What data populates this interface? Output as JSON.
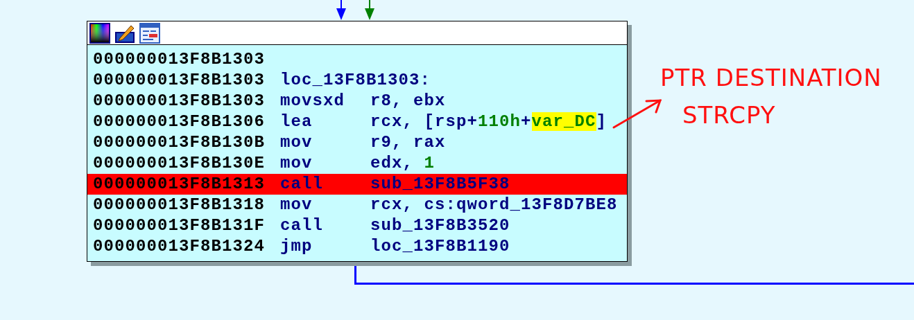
{
  "node": {
    "lines": [
      {
        "address": "000000013F8B1303",
        "selected": false
      },
      {
        "address": "000000013F8B1303",
        "label": "loc_13F8B1303:",
        "selected": false
      },
      {
        "address": "000000013F8B1303",
        "mnemonic": "movsxd",
        "operands": [
          {
            "kind": "plain",
            "text": "r8, ebx"
          }
        ],
        "selected": false
      },
      {
        "address": "000000013F8B1306",
        "mnemonic": "lea",
        "operands": [
          {
            "kind": "plain",
            "text": "rcx, [rsp+"
          },
          {
            "kind": "number",
            "text": "110h"
          },
          {
            "kind": "plain",
            "text": "+"
          },
          {
            "kind": "highlight",
            "text": "var_DC"
          },
          {
            "kind": "plain",
            "text": "]"
          }
        ],
        "selected": false
      },
      {
        "address": "000000013F8B130B",
        "mnemonic": "mov",
        "operands": [
          {
            "kind": "plain",
            "text": "r9, rax"
          }
        ],
        "selected": false
      },
      {
        "address": "000000013F8B130E",
        "mnemonic": "mov",
        "operands": [
          {
            "kind": "plain",
            "text": "edx, "
          },
          {
            "kind": "number",
            "text": "1"
          }
        ],
        "selected": false
      },
      {
        "address": "000000013F8B1313",
        "mnemonic": "call",
        "operands": [
          {
            "kind": "plain",
            "text": "sub_13F8B5F38"
          }
        ],
        "selected": true
      },
      {
        "address": "000000013F8B1318",
        "mnemonic": "mov",
        "operands": [
          {
            "kind": "plain",
            "text": "rcx, cs:qword_13F8D7BE8"
          }
        ],
        "selected": false
      },
      {
        "address": "000000013F8B131F",
        "mnemonic": "call",
        "operands": [
          {
            "kind": "plain",
            "text": "sub_13F8B3520"
          }
        ],
        "selected": false
      },
      {
        "address": "000000013F8B1324",
        "mnemonic": "jmp",
        "operands": [
          {
            "kind": "plain",
            "text": "loc_13F8B1190"
          }
        ],
        "selected": false
      }
    ]
  },
  "annotation": {
    "lines": [
      "PTR DESTINATION",
      "STRCPY"
    ]
  }
}
